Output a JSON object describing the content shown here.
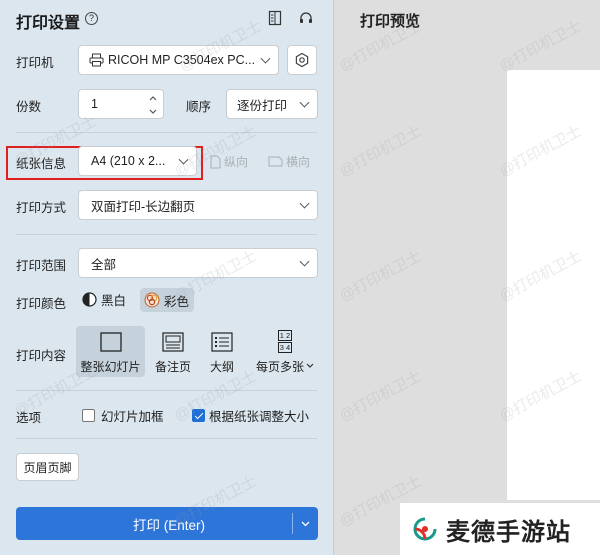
{
  "settings": {
    "title": "打印设置",
    "help_glyph": "?",
    "printer": {
      "label": "打印机",
      "value": "RICOH MP C3504ex PC..."
    },
    "copies": {
      "label": "份数",
      "value": "1"
    },
    "order": {
      "label": "顺序",
      "value": "逐份打印"
    },
    "paper": {
      "label": "纸张信息",
      "value": "A4 (210 x 2...",
      "portrait": "纵向",
      "landscape": "横向"
    },
    "mode": {
      "label": "打印方式",
      "value": "双面打印-长边翻页"
    },
    "range": {
      "label": "打印范围",
      "value": "全部"
    },
    "color": {
      "label": "打印颜色",
      "bw": "黑白",
      "color": "彩色"
    },
    "content": {
      "label": "打印内容",
      "items": [
        "整张幻灯片",
        "备注页",
        "大纲",
        "每页多张"
      ],
      "multi_glyphs": [
        "1 2",
        "3 4"
      ]
    },
    "options": {
      "label": "选项",
      "frame": {
        "label": "幻灯片加框",
        "checked": false
      },
      "fit": {
        "label": "根据纸张调整大小",
        "checked": true
      }
    },
    "header_footer": "页眉页脚",
    "print_button": "打印 (Enter)"
  },
  "preview": {
    "title": "打印预览"
  },
  "watermark": "@打印机卫士",
  "brand": {
    "text": "麦德手游站"
  },
  "colors": {
    "accent": "#2e75d9",
    "highlight": "#e02020",
    "panel": "#dbe6ee"
  }
}
